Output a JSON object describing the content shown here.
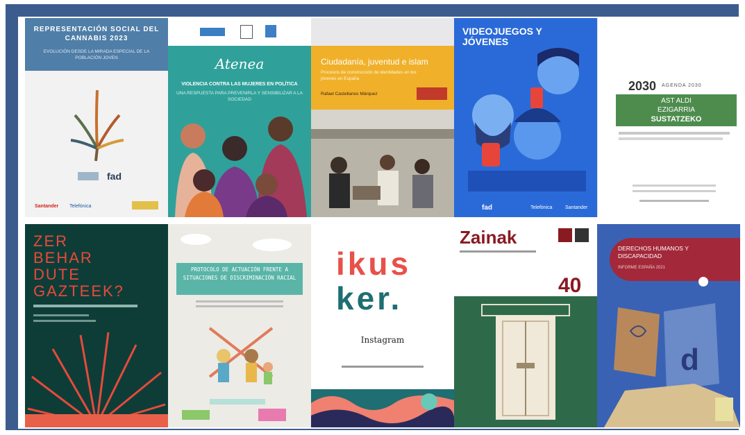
{
  "covers": {
    "cannabis": {
      "title": "REPRESENTACIÓN SOCIAL DEL CANNABIS 2023",
      "subtitle": "EVOLUCIÓN DESDE LA MIRADA ESPECIAL DE LA POBLACIÓN JOVEN",
      "logo_fad": "fad",
      "sponsor1": "Santander",
      "sponsor2": "Telefónica"
    },
    "atenea": {
      "logo": "Atenea",
      "title": "VIOLENCIA CONTRA LAS MUJERES EN POLÍTICA",
      "subtitle": "UNA RESPUESTA PARA PREVENIRLA Y SENSIBILIZAR A LA SOCIEDAD"
    },
    "islam": {
      "title": "Ciudadanía, juventud e islam",
      "subtitle": "Procesos de construcción de identidades en los jóvenes en España",
      "authors": "Rafael Castellanos Márquez"
    },
    "videojuegos": {
      "title": "VIDEOJUEGOS Y JÓVENES",
      "sponsor1": "Telefónica",
      "sponsor2": "Santander",
      "logo_fad": "fad"
    },
    "agenda": {
      "year": "2030",
      "head": "AGENDA 2030",
      "title1": "AST ALDI",
      "title2": "EZIGARRIA",
      "title3": "SUSTATZEKO"
    },
    "gazteek": {
      "line1": "ZER",
      "line2": "BEHAR",
      "line3": "DUTE",
      "line4": "GAZTEEK?"
    },
    "protocolo": {
      "title": "PROTOCOLO DE ACTUACIÓN FRENTE A SITUACIONES DE DISCRIMINACIÓN RACIAL"
    },
    "ikusker": {
      "brand1": "ikus",
      "brand2": "ker.",
      "label": "Instagram"
    },
    "zainak": {
      "title": "Zainak",
      "number": "40"
    },
    "ddhh": {
      "title": "DERECHOS HUMANOS Y DISCAPACIDAD",
      "subtitle": "INFORME ESPAÑA 2021"
    }
  }
}
